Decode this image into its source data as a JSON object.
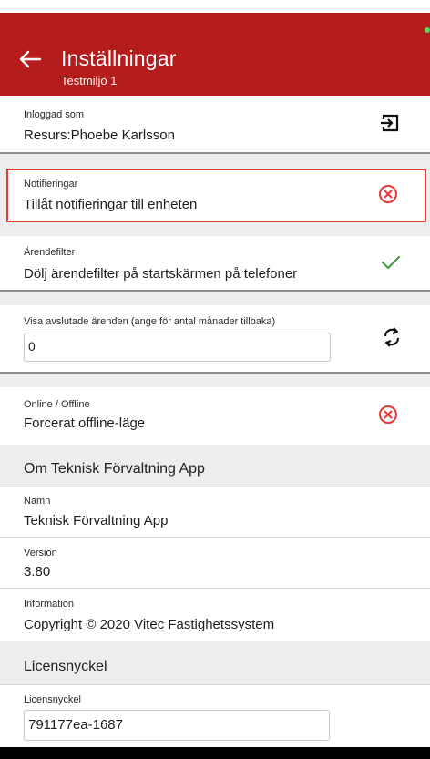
{
  "header": {
    "title": "Inställningar",
    "subtitle": "Testmiljö 1",
    "back_icon": "arrow-left-icon",
    "color": "#b71c1c"
  },
  "logged_in": {
    "label": "Inloggad som",
    "value": "Resurs:Phoebe Karlsson",
    "icon": "logout-icon"
  },
  "notifications": {
    "label": "Notifieringar",
    "value": "Tillåt notifieringar till enheten",
    "icon": "close-circle-icon",
    "state": "off",
    "accent": "#e53935"
  },
  "case_filter": {
    "label": "Ärendefilter",
    "value": "Dölj ärendefilter på startskärmen på telefoner",
    "icon": "check-icon",
    "state": "on",
    "accent": "#43a047"
  },
  "closed_cases": {
    "label": "Visa avslutade ärenden (ange för antal månader tillbaka)",
    "value": "0",
    "icon": "refresh-icon"
  },
  "online_offline": {
    "label": "Online / Offline",
    "value": "Forcerat offline-läge",
    "icon": "close-circle-icon",
    "state": "off"
  },
  "about": {
    "heading": "Om Teknisk Förvaltning App",
    "name_label": "Namn",
    "name_value": "Teknisk Förvaltning App",
    "version_label": "Version",
    "version_value": "3.80",
    "info_label": "Information",
    "info_value": "Copyright © 2020 Vitec Fastighetssystem"
  },
  "license": {
    "heading": "Licensnyckel",
    "label": "Licensnyckel",
    "value": "791177ea-1687"
  }
}
